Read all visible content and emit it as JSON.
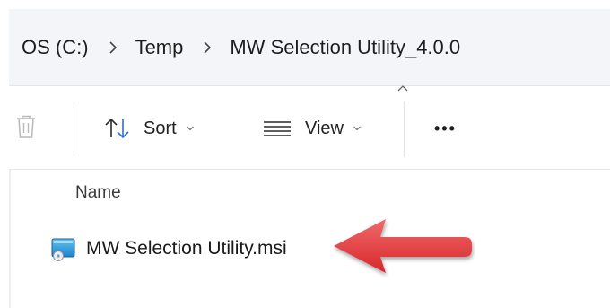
{
  "breadcrumb": [
    {
      "label": "OS (C:)"
    },
    {
      "label": "Temp"
    },
    {
      "label": "MW Selection Utility_4.0.0"
    }
  ],
  "toolbar": {
    "delete_icon": "trash-icon",
    "sort_label": "Sort",
    "view_label": "View",
    "more_label": "•••"
  },
  "file_list": {
    "column_name": "Name",
    "files": [
      {
        "name": "MW Selection Utility.msi",
        "icon": "msi-installer-icon"
      }
    ]
  },
  "annotation": {
    "arrow_color": "#e0383a",
    "direction": "left"
  }
}
